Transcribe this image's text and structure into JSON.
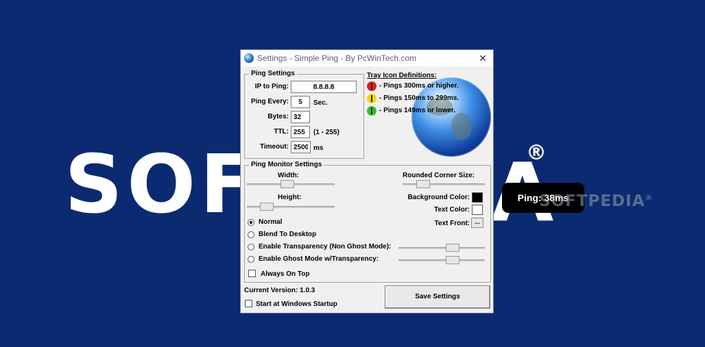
{
  "background": {
    "logo_text": "SOFT",
    "logo_tail": "A",
    "registered": "®",
    "watermark": "SOFTPEDIA",
    "watermark_mark": "®"
  },
  "ping_monitor": {
    "text": "Ping: 38ms"
  },
  "window": {
    "title": "Settings - Simple Ping - By PcWinTech.com",
    "close_glyph": "✕"
  },
  "ping_settings": {
    "title": "Ping Settings",
    "ip_label": "IP to Ping:",
    "ip_value": "8.8.8.8",
    "every_label": "Ping Every:",
    "every_value": "5",
    "every_unit": "Sec.",
    "bytes_label": "Bytes:",
    "bytes_value": "32",
    "ttl_label": "TTL:",
    "ttl_value": "255",
    "ttl_range": "(1 - 255)",
    "timeout_label": "Timeout:",
    "timeout_value": "2500",
    "timeout_unit": "ms"
  },
  "tray_icons": {
    "title": "Tray Icon Definitions:",
    "items": [
      {
        "text": "- Pings 300ms or higher.",
        "color": "#e02020"
      },
      {
        "text": "- Pings 150ms to 299ms.",
        "color": "#f0d800"
      },
      {
        "text": "- Pings 149ms or lower.",
        "color": "#30c030"
      }
    ]
  },
  "monitor_settings": {
    "title": "Ping Monitor Settings",
    "width_label": "Width:",
    "width_level": 0.45,
    "height_label": "Height:",
    "height_level": 0.18,
    "rounded_label": "Rounded Corner Size:",
    "rounded_level": 0.2,
    "bg_color_label": "Background Color:",
    "bg_color": "#000000",
    "text_color_label": "Text Color:",
    "text_color": "#ffffff",
    "text_font_label": "Text Front:",
    "text_font_button": "...",
    "modes": [
      {
        "label": "Normal",
        "selected": true
      },
      {
        "label": "Blend To Desktop",
        "selected": false
      },
      {
        "label": "Enable Transparency (Non Ghost Mode):",
        "selected": false
      },
      {
        "label": "Enable Ghost Mode w/Transparency:",
        "selected": false
      }
    ],
    "transparency_level": 0.65,
    "ghost_level": 0.65,
    "always_on_top_label": "Always On Top",
    "always_on_top": false
  },
  "footer": {
    "version_text": "Current Version: 1.0.3",
    "startup_label": "Start at Windows Startup",
    "startup_checked": false,
    "save_label": "Save Settings"
  }
}
